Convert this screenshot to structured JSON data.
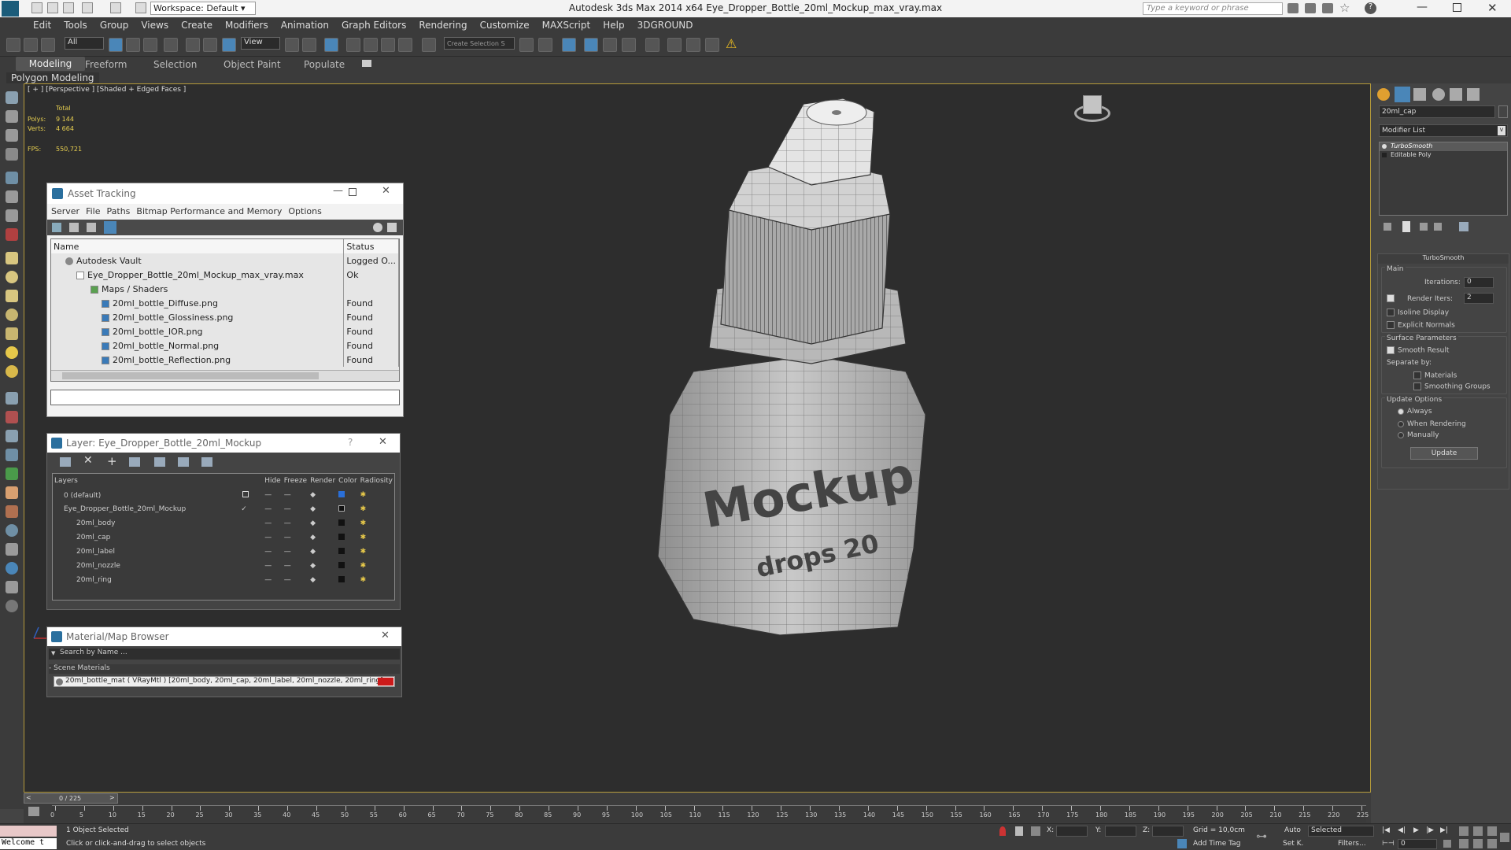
{
  "titlebar": {
    "workspace": "Workspace: Default",
    "title": "Autodesk 3ds Max  2014 x64     Eye_Dropper_Bottle_20ml_Mockup_max_vray.max",
    "search_placeholder": "Type a keyword or phrase"
  },
  "menu": [
    "Edit",
    "Tools",
    "Group",
    "Views",
    "Create",
    "Modifiers",
    "Animation",
    "Graph Editors",
    "Rendering",
    "Customize",
    "MAXScript",
    "Help",
    "3DGROUND"
  ],
  "toolbar": {
    "filter": "All",
    "view_dropdown": "View",
    "selection_set": "Create Selection S"
  },
  "ribbon": {
    "tabs": [
      "Modeling",
      "Freeform",
      "Selection",
      "Object Paint",
      "Populate"
    ],
    "sub": "Polygon Modeling"
  },
  "viewport": {
    "label": "[ + ] [Perspective ] [Shaded + Edged Faces ]",
    "stats": {
      "total": "Total",
      "polys_label": "Polys:",
      "polys": "9 144",
      "verts_label": "Verts:",
      "verts": "4 664",
      "fps_label": "FPS:",
      "fps": "550,721"
    }
  },
  "asset_tracking": {
    "title": "Asset Tracking",
    "menu": [
      "Server",
      "File",
      "Paths",
      "Bitmap Performance and Memory",
      "Options"
    ],
    "col_name": "Name",
    "col_status": "Status",
    "rows": [
      {
        "name": "Autodesk Vault",
        "status": "Logged O..."
      },
      {
        "name": "Eye_Dropper_Bottle_20ml_Mockup_max_vray.max",
        "status": "Ok"
      },
      {
        "name": "Maps / Shaders",
        "status": ""
      },
      {
        "name": "20ml_bottle_Diffuse.png",
        "status": "Found"
      },
      {
        "name": "20ml_bottle_Glossiness.png",
        "status": "Found"
      },
      {
        "name": "20ml_bottle_IOR.png",
        "status": "Found"
      },
      {
        "name": "20ml_bottle_Normal.png",
        "status": "Found"
      },
      {
        "name": "20ml_bottle_Reflection.png",
        "status": "Found"
      }
    ]
  },
  "layer": {
    "title": "Layer: Eye_Dropper_Bottle_20ml_Mockup",
    "help": "?",
    "cols": [
      "Layers",
      "Hide",
      "Freeze",
      "Render",
      "Color",
      "Radiosity"
    ],
    "rows": [
      {
        "name": "0 (default)",
        "indent": 1
      },
      {
        "name": "Eye_Dropper_Bottle_20ml_Mockup",
        "indent": 1
      },
      {
        "name": "20ml_body",
        "indent": 2
      },
      {
        "name": "20ml_cap",
        "indent": 2
      },
      {
        "name": "20ml_label",
        "indent": 2
      },
      {
        "name": "20ml_nozzle",
        "indent": 2
      },
      {
        "name": "20ml_ring",
        "indent": 2
      }
    ]
  },
  "material_browser": {
    "title": "Material/Map Browser",
    "search_placeholder": "Search by Name ...",
    "group": "- Scene Materials",
    "item": "20ml_bottle_mat  ( VRayMtl ) [20ml_body, 20ml_cap, 20ml_label, 20ml_nozzle, 20ml_ring]"
  },
  "command_panel": {
    "object_name": "20ml_cap",
    "modifier_list": "Modifier List",
    "stack": [
      "TurboSmooth",
      "Editable Poly"
    ],
    "rollout_title": "TurboSmooth",
    "main": "Main",
    "iterations_label": "Iterations:",
    "iterations": "0",
    "render_iters_label": "Render Iters:",
    "render_iters": "2",
    "isoline": "Isoline Display",
    "explicit": "Explicit Normals",
    "surface": "Surface Parameters",
    "smooth_result": "Smooth Result",
    "separate_by": "Separate by:",
    "materials": "Materials",
    "smoothing_groups": "Smoothing Groups",
    "update_options": "Update Options",
    "always": "Always",
    "when_rendering": "When Rendering",
    "manually": "Manually",
    "update_btn": "Update"
  },
  "timeline": {
    "frame": "0 / 225",
    "ticks": [
      "0",
      "5",
      "10",
      "15",
      "20",
      "25",
      "30",
      "35",
      "40",
      "45",
      "50",
      "55",
      "60",
      "65",
      "70",
      "75",
      "80",
      "85",
      "90",
      "95",
      "100",
      "105",
      "110",
      "115",
      "120",
      "125",
      "130",
      "135",
      "140",
      "145",
      "150",
      "155",
      "160",
      "165",
      "170",
      "175",
      "180",
      "185",
      "190",
      "195",
      "200",
      "205",
      "210",
      "215",
      "220",
      "225"
    ]
  },
  "status": {
    "welcome": "Welcome t",
    "selected": "1 Object Selected",
    "prompt": "Click or click-and-drag to select objects",
    "x": "X:",
    "y": "Y:",
    "z": "Z:",
    "grid": "Grid = 10,0cm",
    "add_time_tag": "Add Time Tag",
    "auto": "Auto",
    "selected_dd": "Selected",
    "setk": "Set K.",
    "filters": "Filters...",
    "frame_field": "0"
  },
  "mesh": {
    "label_text": "Mockup",
    "drops_text": "drops 20"
  }
}
